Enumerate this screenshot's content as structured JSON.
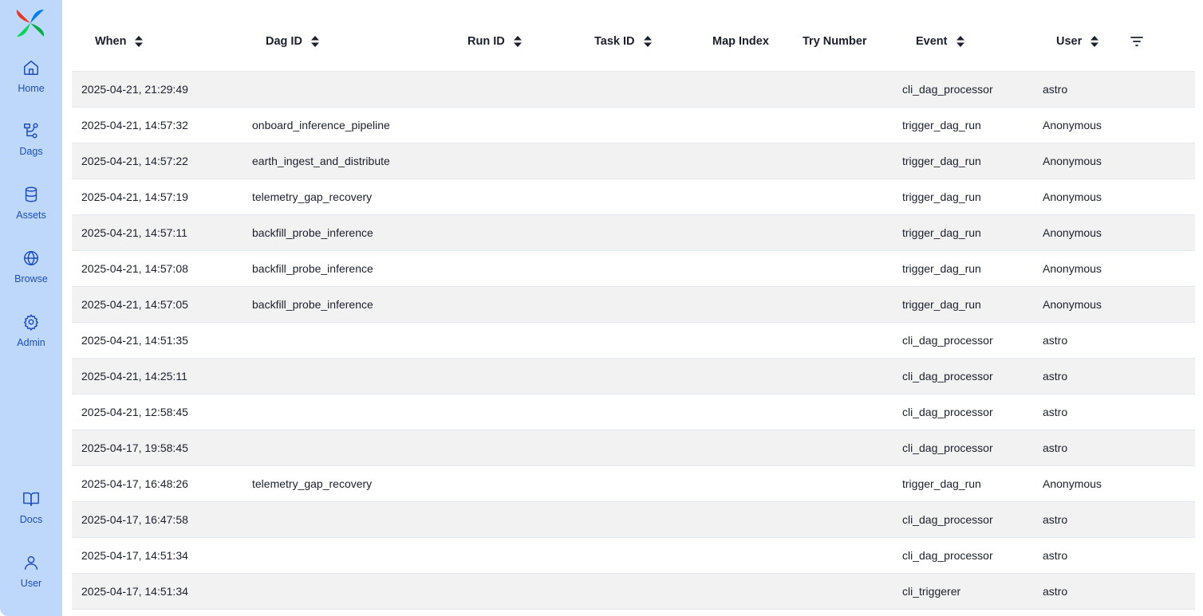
{
  "sidebar": {
    "items": [
      {
        "label": "Home",
        "icon": "home-icon"
      },
      {
        "label": "Dags",
        "icon": "dags-icon"
      },
      {
        "label": "Assets",
        "icon": "database-icon"
      },
      {
        "label": "Browse",
        "icon": "globe-icon"
      },
      {
        "label": "Admin",
        "icon": "gear-icon"
      },
      {
        "label": "Docs",
        "icon": "book-icon"
      },
      {
        "label": "User",
        "icon": "user-icon"
      }
    ],
    "colors": {
      "background": "#bed8fb",
      "accent": "#1e4db7"
    }
  },
  "table": {
    "columns": [
      {
        "label": "When",
        "sortable": true
      },
      {
        "label": "Dag ID",
        "sortable": true
      },
      {
        "label": "Run ID",
        "sortable": true
      },
      {
        "label": "Task ID",
        "sortable": true
      },
      {
        "label": "Map Index",
        "sortable": false
      },
      {
        "label": "Try Number",
        "sortable": false
      },
      {
        "label": "Event",
        "sortable": true
      },
      {
        "label": "User",
        "sortable": true
      }
    ],
    "rows": [
      {
        "when": "2025-04-21, 21:29:49",
        "dag_id": "",
        "run_id": "",
        "task_id": "",
        "map_index": "",
        "try_number": "",
        "event": "cli_dag_processor",
        "user": "astro"
      },
      {
        "when": "2025-04-21, 14:57:32",
        "dag_id": "onboard_inference_pipeline",
        "run_id": "",
        "task_id": "",
        "map_index": "",
        "try_number": "",
        "event": "trigger_dag_run",
        "user": "Anonymous"
      },
      {
        "when": "2025-04-21, 14:57:22",
        "dag_id": "earth_ingest_and_distribute",
        "run_id": "",
        "task_id": "",
        "map_index": "",
        "try_number": "",
        "event": "trigger_dag_run",
        "user": "Anonymous"
      },
      {
        "when": "2025-04-21, 14:57:19",
        "dag_id": "telemetry_gap_recovery",
        "run_id": "",
        "task_id": "",
        "map_index": "",
        "try_number": "",
        "event": "trigger_dag_run",
        "user": "Anonymous"
      },
      {
        "when": "2025-04-21, 14:57:11",
        "dag_id": "backfill_probe_inference",
        "run_id": "",
        "task_id": "",
        "map_index": "",
        "try_number": "",
        "event": "trigger_dag_run",
        "user": "Anonymous"
      },
      {
        "when": "2025-04-21, 14:57:08",
        "dag_id": "backfill_probe_inference",
        "run_id": "",
        "task_id": "",
        "map_index": "",
        "try_number": "",
        "event": "trigger_dag_run",
        "user": "Anonymous"
      },
      {
        "when": "2025-04-21, 14:57:05",
        "dag_id": "backfill_probe_inference",
        "run_id": "",
        "task_id": "",
        "map_index": "",
        "try_number": "",
        "event": "trigger_dag_run",
        "user": "Anonymous"
      },
      {
        "when": "2025-04-21, 14:51:35",
        "dag_id": "",
        "run_id": "",
        "task_id": "",
        "map_index": "",
        "try_number": "",
        "event": "cli_dag_processor",
        "user": "astro"
      },
      {
        "when": "2025-04-21, 14:25:11",
        "dag_id": "",
        "run_id": "",
        "task_id": "",
        "map_index": "",
        "try_number": "",
        "event": "cli_dag_processor",
        "user": "astro"
      },
      {
        "when": "2025-04-21, 12:58:45",
        "dag_id": "",
        "run_id": "",
        "task_id": "",
        "map_index": "",
        "try_number": "",
        "event": "cli_dag_processor",
        "user": "astro"
      },
      {
        "when": "2025-04-17, 19:58:45",
        "dag_id": "",
        "run_id": "",
        "task_id": "",
        "map_index": "",
        "try_number": "",
        "event": "cli_dag_processor",
        "user": "astro"
      },
      {
        "when": "2025-04-17, 16:48:26",
        "dag_id": "telemetry_gap_recovery",
        "run_id": "",
        "task_id": "",
        "map_index": "",
        "try_number": "",
        "event": "trigger_dag_run",
        "user": "Anonymous"
      },
      {
        "when": "2025-04-17, 16:47:58",
        "dag_id": "",
        "run_id": "",
        "task_id": "",
        "map_index": "",
        "try_number": "",
        "event": "cli_dag_processor",
        "user": "astro"
      },
      {
        "when": "2025-04-17, 14:51:34",
        "dag_id": "",
        "run_id": "",
        "task_id": "",
        "map_index": "",
        "try_number": "",
        "event": "cli_dag_processor",
        "user": "astro"
      },
      {
        "when": "2025-04-17, 14:51:34",
        "dag_id": "",
        "run_id": "",
        "task_id": "",
        "map_index": "",
        "try_number": "",
        "event": "cli_triggerer",
        "user": "astro"
      }
    ],
    "filter_icon": "filter-icon",
    "colors": {
      "row_stripe": "#f2f2f2",
      "border": "#e2e8f0"
    }
  }
}
